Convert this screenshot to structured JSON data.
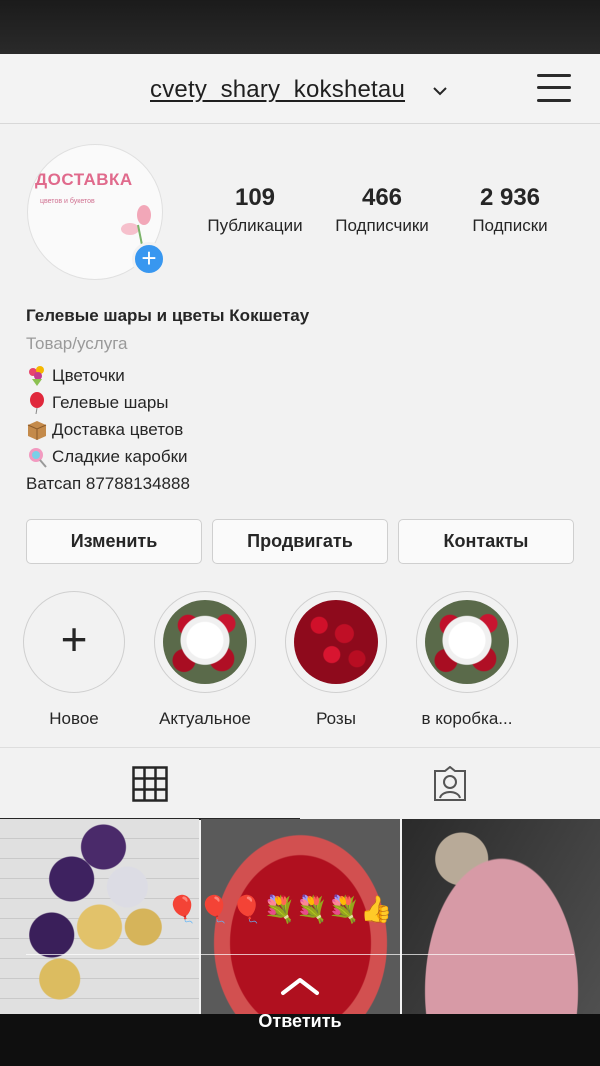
{
  "header": {
    "username": "cvety_shary_kokshetau"
  },
  "avatar": {
    "title": "ДОСТАВКА",
    "subtitle": "цветов и букетов"
  },
  "stats": [
    {
      "value": "109",
      "label": "Публикации"
    },
    {
      "value": "466",
      "label": "Подписчики"
    },
    {
      "value": "2 936",
      "label": "Подписки"
    }
  ],
  "bio": {
    "name": "Гелевые шары и цветы Кокшетау",
    "category": "Товар/услуга",
    "lines": [
      "Цветочки",
      "Гелевые шары",
      "Доставка цветов",
      "Сладкие каробки"
    ],
    "contact": "Ватсап 87788134888"
  },
  "buttons": {
    "edit": "Изменить",
    "promote": "Продвигать",
    "contacts": "Контакты"
  },
  "highlights": [
    {
      "label": "Новое"
    },
    {
      "label": "Актуальное"
    },
    {
      "label": "Розы"
    },
    {
      "label": "в коробка..."
    }
  ],
  "story": {
    "emoji": "🎈🎈🎈💐💐💐👍",
    "reply_label": "Ответить"
  },
  "colors": {
    "accent": "#3897f0",
    "text": "#262626",
    "muted": "#9a9a9a"
  }
}
